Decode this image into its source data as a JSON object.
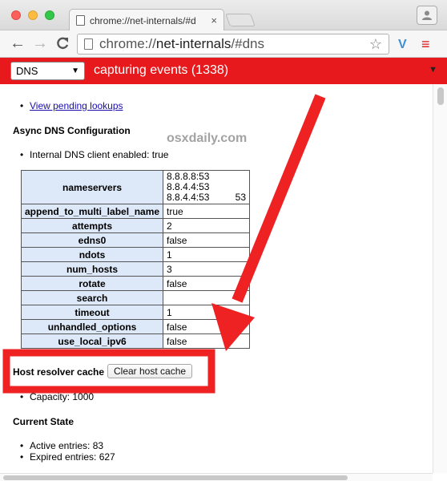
{
  "window": {
    "tab_title": "chrome://net-internals/#d",
    "tab_close": "×",
    "profile_icon": "person-icon"
  },
  "toolbar": {
    "back": "←",
    "forward": "→",
    "reload": "C",
    "url_scheme": "chrome://",
    "url_host": "net-internals",
    "url_path": "/#dns",
    "star": "☆",
    "extension": "V",
    "menu": "≡"
  },
  "status": {
    "view_selected": "DNS",
    "view_caret": "▼",
    "capture_text": "capturing events (1338)",
    "menu_caret": "▼"
  },
  "content": {
    "pending_link": "View pending lookups",
    "async_heading": "Async DNS Configuration",
    "internal_dns": "Internal DNS client enabled: true",
    "watermark": "osxdaily.com",
    "config": {
      "nameservers_label": "nameservers",
      "nameservers": [
        "8.8.8.8:53",
        "8.8.4.4:53",
        "8.8.4.4:53"
      ],
      "nameservers_extra": "53",
      "rows": [
        {
          "key": "append_to_multi_label_name",
          "value": "true"
        },
        {
          "key": "attempts",
          "value": "2"
        },
        {
          "key": "edns0",
          "value": "false"
        },
        {
          "key": "ndots",
          "value": "1"
        },
        {
          "key": "num_hosts",
          "value": "3"
        },
        {
          "key": "rotate",
          "value": "false"
        },
        {
          "key": "search",
          "value": ""
        },
        {
          "key": "timeout",
          "value": "1"
        },
        {
          "key": "unhandled_options",
          "value": "false"
        },
        {
          "key": "use_local_ipv6",
          "value": "false"
        }
      ]
    },
    "host_cache_heading": "Host resolver cache",
    "clear_button": "Clear host cache",
    "capacity": "Capacity: 1000",
    "current_state_heading": "Current State",
    "active_entries": "Active entries: 83",
    "expired_entries": "Expired entries: 627"
  },
  "annotation": {
    "highlight_color": "#ee2222",
    "arrow_color": "#ee2222"
  }
}
